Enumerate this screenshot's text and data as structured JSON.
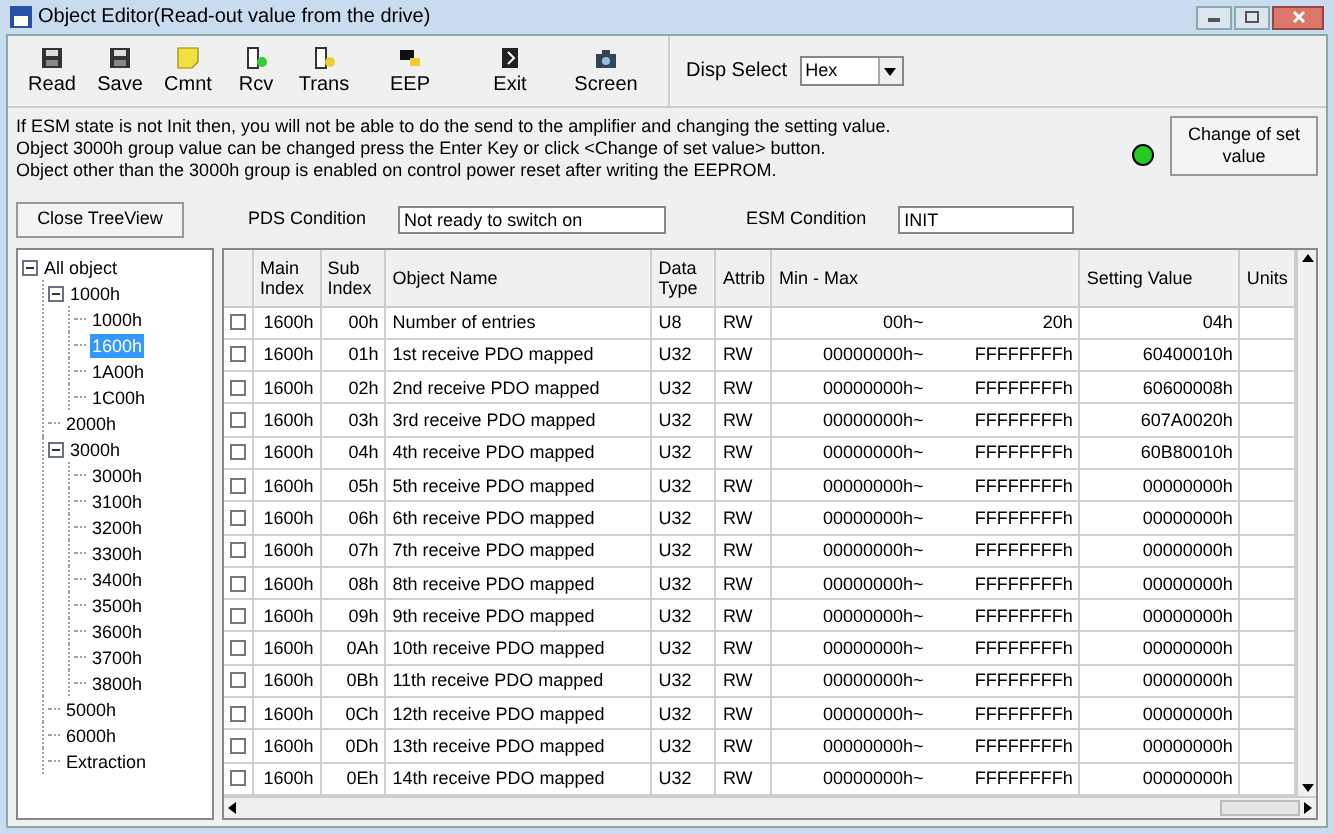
{
  "window": {
    "title": "Object Editor(Read-out value from the drive)"
  },
  "toolbar": [
    {
      "label": "Read",
      "kind": "disk"
    },
    {
      "label": "Save",
      "kind": "disk"
    },
    {
      "label": "Cmnt",
      "kind": "note"
    },
    {
      "label": "Rcv",
      "kind": "recv"
    },
    {
      "label": "Trans",
      "kind": "trans"
    },
    {
      "label": "EEP",
      "kind": "eep"
    },
    {
      "label": "Exit",
      "kind": "exit"
    },
    {
      "label": "Screen",
      "kind": "camera"
    }
  ],
  "disp_select": {
    "label": "Disp Select",
    "value": "Hex"
  },
  "messages": [
    "If ESM state is not Init then, you will not be able to do the send to the amplifier and changing the setting value.",
    "Object 3000h group value can be changed press the Enter Key or click <Change of set value> button.",
    "Object other than the 3000h group is enabled on control power reset after writing the EEPROM."
  ],
  "status_led": {
    "color": "#22cc22"
  },
  "change_button": "Change of set value",
  "close_treeview": "Close TreeView",
  "pds": {
    "label": "PDS Condition",
    "value": "Not ready to switch on"
  },
  "esm": {
    "label": "ESM Condition",
    "value": "INIT"
  },
  "tree": [
    {
      "label": "All object",
      "expanded": true,
      "selected": false,
      "children": [
        {
          "label": "1000h",
          "expanded": true,
          "selected": false,
          "children": [
            {
              "label": "1000h",
              "selected": false
            },
            {
              "label": "1600h",
              "selected": true
            },
            {
              "label": "1A00h",
              "selected": false
            },
            {
              "label": "1C00h",
              "selected": false
            }
          ]
        },
        {
          "label": "2000h",
          "selected": false
        },
        {
          "label": "3000h",
          "expanded": true,
          "selected": false,
          "children": [
            {
              "label": "3000h",
              "selected": false
            },
            {
              "label": "3100h",
              "selected": false
            },
            {
              "label": "3200h",
              "selected": false
            },
            {
              "label": "3300h",
              "selected": false
            },
            {
              "label": "3400h",
              "selected": false
            },
            {
              "label": "3500h",
              "selected": false
            },
            {
              "label": "3600h",
              "selected": false
            },
            {
              "label": "3700h",
              "selected": false
            },
            {
              "label": "3800h",
              "selected": false
            }
          ]
        },
        {
          "label": "5000h",
          "selected": false
        },
        {
          "label": "6000h",
          "selected": false
        },
        {
          "label": "Extraction",
          "selected": false
        }
      ]
    }
  ],
  "table": {
    "columns": [
      "Main Index",
      "Sub Index",
      "Object Name",
      "Data Type",
      "Attrib",
      "Min - Max",
      "Setting Value",
      "Units"
    ],
    "rows": [
      {
        "checked": false,
        "main": "1600h",
        "sub": "00h",
        "name": "Number of entries",
        "type": "U8",
        "attrib": "RW",
        "min": "00h~",
        "max": "20h",
        "value": "04h"
      },
      {
        "checked": false,
        "main": "1600h",
        "sub": "01h",
        "name": "1st receive PDO mapped",
        "type": "U32",
        "attrib": "RW",
        "min": "00000000h~",
        "max": "FFFFFFFFh",
        "value": "60400010h"
      },
      {
        "checked": false,
        "main": "1600h",
        "sub": "02h",
        "name": "2nd receive PDO mapped",
        "type": "U32",
        "attrib": "RW",
        "min": "00000000h~",
        "max": "FFFFFFFFh",
        "value": "60600008h"
      },
      {
        "checked": false,
        "main": "1600h",
        "sub": "03h",
        "name": "3rd receive PDO mapped",
        "type": "U32",
        "attrib": "RW",
        "min": "00000000h~",
        "max": "FFFFFFFFh",
        "value": "607A0020h"
      },
      {
        "checked": false,
        "main": "1600h",
        "sub": "04h",
        "name": "4th receive PDO mapped",
        "type": "U32",
        "attrib": "RW",
        "min": "00000000h~",
        "max": "FFFFFFFFh",
        "value": "60B80010h"
      },
      {
        "checked": false,
        "main": "1600h",
        "sub": "05h",
        "name": "5th receive PDO mapped",
        "type": "U32",
        "attrib": "RW",
        "min": "00000000h~",
        "max": "FFFFFFFFh",
        "value": "00000000h"
      },
      {
        "checked": false,
        "main": "1600h",
        "sub": "06h",
        "name": "6th receive PDO mapped",
        "type": "U32",
        "attrib": "RW",
        "min": "00000000h~",
        "max": "FFFFFFFFh",
        "value": "00000000h"
      },
      {
        "checked": false,
        "main": "1600h",
        "sub": "07h",
        "name": "7th receive PDO mapped",
        "type": "U32",
        "attrib": "RW",
        "min": "00000000h~",
        "max": "FFFFFFFFh",
        "value": "00000000h"
      },
      {
        "checked": false,
        "main": "1600h",
        "sub": "08h",
        "name": "8th receive PDO mapped",
        "type": "U32",
        "attrib": "RW",
        "min": "00000000h~",
        "max": "FFFFFFFFh",
        "value": "00000000h"
      },
      {
        "checked": false,
        "main": "1600h",
        "sub": "09h",
        "name": "9th receive PDO mapped",
        "type": "U32",
        "attrib": "RW",
        "min": "00000000h~",
        "max": "FFFFFFFFh",
        "value": "00000000h"
      },
      {
        "checked": false,
        "main": "1600h",
        "sub": "0Ah",
        "name": "10th receive PDO mapped",
        "type": "U32",
        "attrib": "RW",
        "min": "00000000h~",
        "max": "FFFFFFFFh",
        "value": "00000000h"
      },
      {
        "checked": false,
        "main": "1600h",
        "sub": "0Bh",
        "name": "11th receive PDO mapped",
        "type": "U32",
        "attrib": "RW",
        "min": "00000000h~",
        "max": "FFFFFFFFh",
        "value": "00000000h"
      },
      {
        "checked": false,
        "main": "1600h",
        "sub": "0Ch",
        "name": "12th receive PDO mapped",
        "type": "U32",
        "attrib": "RW",
        "min": "00000000h~",
        "max": "FFFFFFFFh",
        "value": "00000000h"
      },
      {
        "checked": false,
        "main": "1600h",
        "sub": "0Dh",
        "name": "13th receive PDO mapped",
        "type": "U32",
        "attrib": "RW",
        "min": "00000000h~",
        "max": "FFFFFFFFh",
        "value": "00000000h"
      },
      {
        "checked": false,
        "main": "1600h",
        "sub": "0Eh",
        "name": "14th receive PDO mapped",
        "type": "U32",
        "attrib": "RW",
        "min": "00000000h~",
        "max": "FFFFFFFFh",
        "value": "00000000h"
      }
    ]
  }
}
